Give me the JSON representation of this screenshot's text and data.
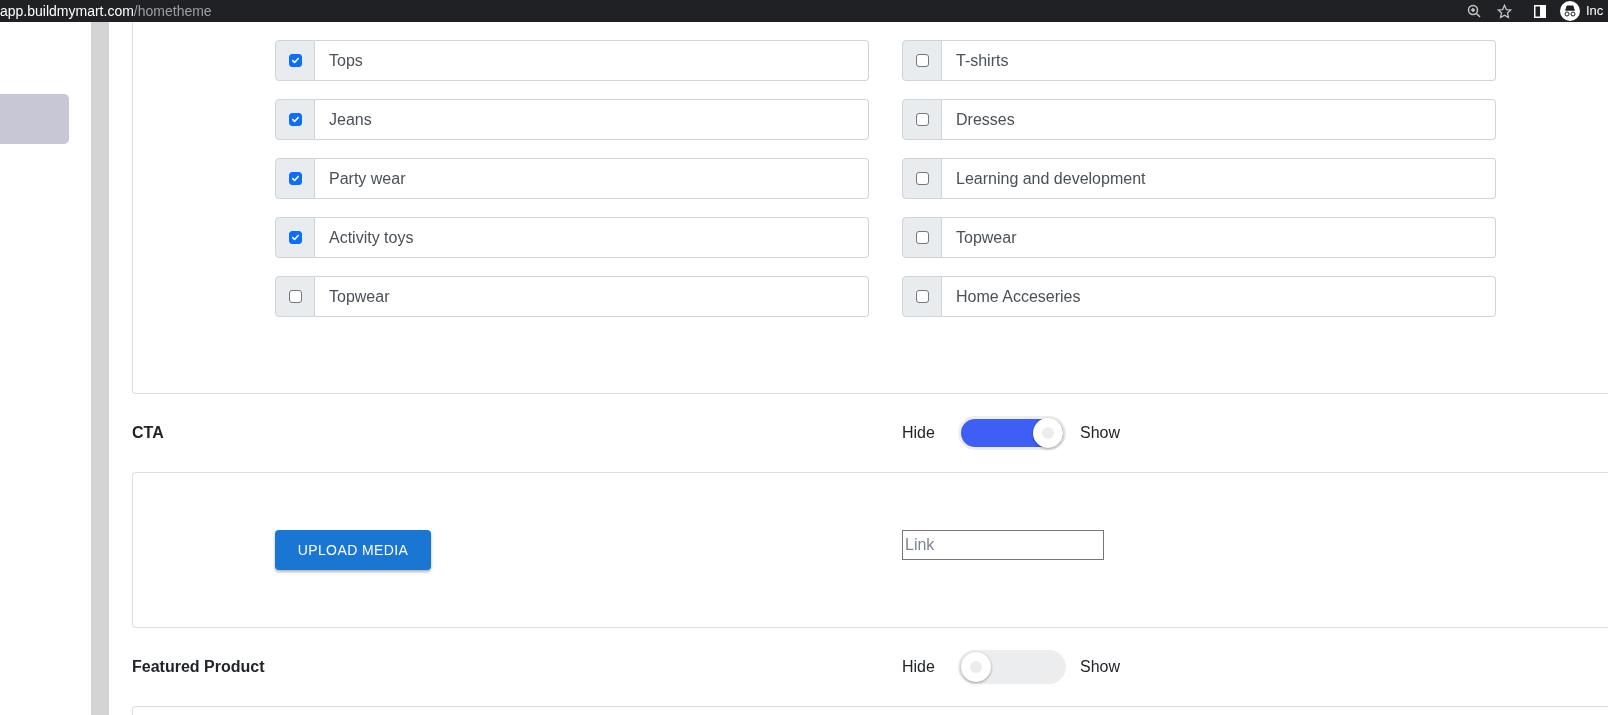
{
  "browser": {
    "url_host": "app.buildmymart.com",
    "url_path": "/hometheme",
    "profile_label": "Inc"
  },
  "categories": [
    {
      "label": "Tops",
      "checked": true
    },
    {
      "label": "T-shirts",
      "checked": false
    },
    {
      "label": "Jeans",
      "checked": true
    },
    {
      "label": "Dresses",
      "checked": false
    },
    {
      "label": "Party wear",
      "checked": true
    },
    {
      "label": "Learning and development",
      "checked": false
    },
    {
      "label": "Activity toys",
      "checked": true
    },
    {
      "label": "Topwear",
      "checked": false
    },
    {
      "label": "Topwear",
      "checked": false
    },
    {
      "label": "Home Acceseries",
      "checked": false
    }
  ],
  "sections": [
    {
      "title": "CTA",
      "hide_label": "Hide",
      "show_label": "Show",
      "on": true,
      "upload_button": "UPLOAD MEDIA",
      "link_placeholder": "Link"
    },
    {
      "title": "Featured Product",
      "hide_label": "Hide",
      "show_label": "Show",
      "on": false
    }
  ]
}
